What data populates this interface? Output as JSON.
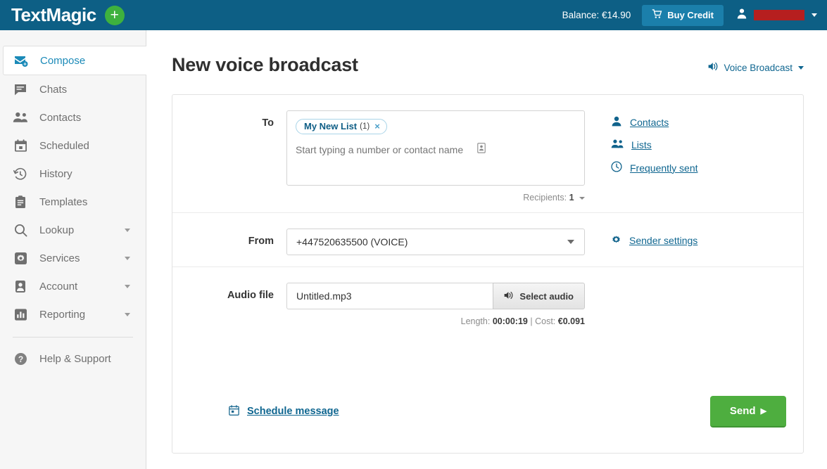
{
  "topbar": {
    "brand": "TextMagic",
    "add_button_label": "+",
    "balance": "Balance: €14.90",
    "buy_credit_label": "Buy Credit",
    "user_name": ""
  },
  "sidebar": {
    "items": [
      {
        "label": "Compose",
        "icon": "compose-icon",
        "active": true,
        "caret": false
      },
      {
        "label": "Chats",
        "icon": "chat-icon",
        "active": false,
        "caret": false
      },
      {
        "label": "Contacts",
        "icon": "contacts-icon",
        "active": false,
        "caret": false
      },
      {
        "label": "Scheduled",
        "icon": "calendar-icon",
        "active": false,
        "caret": false
      },
      {
        "label": "History",
        "icon": "history-icon",
        "active": false,
        "caret": false
      },
      {
        "label": "Templates",
        "icon": "clipboard-icon",
        "active": false,
        "caret": false
      },
      {
        "label": "Lookup",
        "icon": "search-icon",
        "active": false,
        "caret": true
      },
      {
        "label": "Services",
        "icon": "gear-icon",
        "active": false,
        "caret": true
      },
      {
        "label": "Account",
        "icon": "person-icon",
        "active": false,
        "caret": true
      },
      {
        "label": "Reporting",
        "icon": "chart-icon",
        "active": false,
        "caret": true
      }
    ],
    "help": {
      "label": "Help & Support",
      "icon": "question-icon"
    }
  },
  "main": {
    "title": "New voice broadcast",
    "mode_switch": {
      "label": "Voice Broadcast",
      "icon": "speaker-icon"
    }
  },
  "form": {
    "to": {
      "label": "To",
      "chip": {
        "name": "My New List",
        "count": "(1)",
        "remove": "×"
      },
      "placeholder": "Start typing a number or contact name",
      "value": "",
      "recipients_label": "Recipients:",
      "recipients_count": "1",
      "links": [
        {
          "label": "Contacts",
          "icon": "person-icon"
        },
        {
          "label": "Lists",
          "icon": "people-icon"
        },
        {
          "label": "Frequently sent",
          "icon": "clock-icon"
        }
      ]
    },
    "from": {
      "label": "From",
      "value": "+447520635500 (VOICE)",
      "sender_settings_label": "Sender settings"
    },
    "audio": {
      "label": "Audio file",
      "file_name": "Untitled.mp3",
      "select_button_label": "Select audio",
      "length_label": "Length:",
      "length_value": "00:00:19",
      "separator": "|",
      "cost_label": "Cost:",
      "cost_value": "€0.091"
    },
    "footer": {
      "schedule_label": "Schedule message",
      "send_label": "Send",
      "send_arrow": "▶"
    }
  },
  "colors": {
    "header_blue": "#0d5f85",
    "accent_blue": "#1b8ab8",
    "link_blue": "#0f6690",
    "green": "#4eae3f",
    "add_green": "#3eb13e",
    "redacted_red": "#b61f1f"
  }
}
